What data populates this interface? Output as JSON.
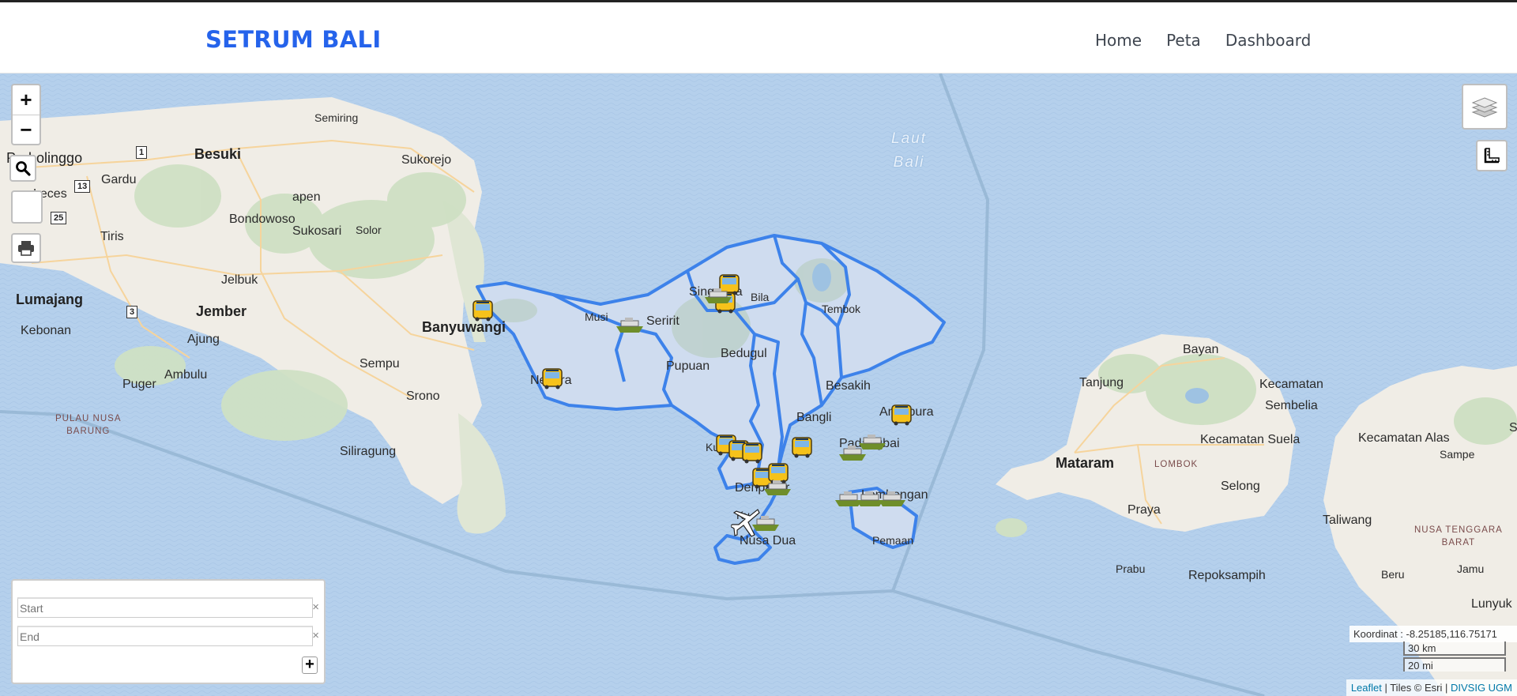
{
  "navbar": {
    "brand": "SETRUM BALI",
    "links": [
      "Home",
      "Peta",
      "Dashboard"
    ]
  },
  "map": {
    "controls": {
      "zoom_in": "+",
      "zoom_out": "−",
      "icons": [
        "search-icon",
        "print-icon",
        "layers-icon",
        "measure-icon"
      ]
    },
    "routing": {
      "start_placeholder": "Start",
      "end_placeholder": "End",
      "clear": "×",
      "add": "+"
    },
    "coordinates": "Koordinat : -8.25185,116.75171",
    "scale": {
      "km": "30 km",
      "mi": "20 mi"
    },
    "attribution": {
      "leaflet": "Leaflet",
      "tiles": " | Tiles © Esri | ",
      "org": "DIVSIG UGM"
    },
    "sea_label": [
      "Laut",
      "Bali"
    ],
    "places": {
      "probolinggo": "Probolinggo",
      "besuki": "Besuki",
      "semiring": "Semiring",
      "sukorejo": "Sukorejo",
      "gardu": "Gardu",
      "leces": "Leces",
      "tiris": "Tiris",
      "bondowoso": "Bondowoso",
      "tapen": "apen",
      "sukosari": "Sukosari",
      "solor": "Solor",
      "jelbuk": "Jelbuk",
      "lumajang": "Lumajang",
      "jember": "Jember",
      "banyuwangi": "Banyuwangi",
      "kebonan": "Kebonan",
      "ajung": "Ajung",
      "sempu": "Sempu",
      "ambulu": "Ambulu",
      "puger": "Puger",
      "srono": "Srono",
      "pulau_nusa_barung": [
        "PULAU NUSA",
        "BARUNG"
      ],
      "siliragung": "Siliragung",
      "singaraja": "Singaraja",
      "bila": "Bila",
      "tembok": "Tembok",
      "seririt": "Seririt",
      "musi": "Musi",
      "pupuan": "Pupuan",
      "bedugul": "Bedugul",
      "negara": "Negara",
      "besakih": "Besakih",
      "amlapura": "Amlapura",
      "bangli": "Bangli",
      "padangbai": "Padangbai",
      "kuta": "Kuta",
      "denpasar": "Denpasar",
      "kuta_south": "Ku",
      "nusa_dua": "Nusa Dua",
      "lembongan": "Lembongan",
      "pemaan": "Pemaan",
      "mataram": "Mataram",
      "lombok": "LOMBOK",
      "bayan": "Bayan",
      "tanjung": "Tanjung",
      "kecamatan_sembelia": [
        "Kecamatan",
        "Sembelia"
      ],
      "kecamatan_suela": "Kecamatan Suela",
      "kecamatan_alas": "Kecamatan Alas",
      "selong": "Selong",
      "praya": "Praya",
      "prabu": "Prabu",
      "repoksampih": "Repoksampih",
      "taliwang": "Taliwang",
      "sampe": "Sampe",
      "ntb": [
        "NUSA TENGGARA",
        "BARAT"
      ],
      "jamu": "Jamu",
      "beru": "Beru",
      "lunyuk": "Lunyuk",
      "s_cut": "S"
    },
    "route_shields": [
      "1",
      "13",
      "25",
      "3"
    ]
  }
}
